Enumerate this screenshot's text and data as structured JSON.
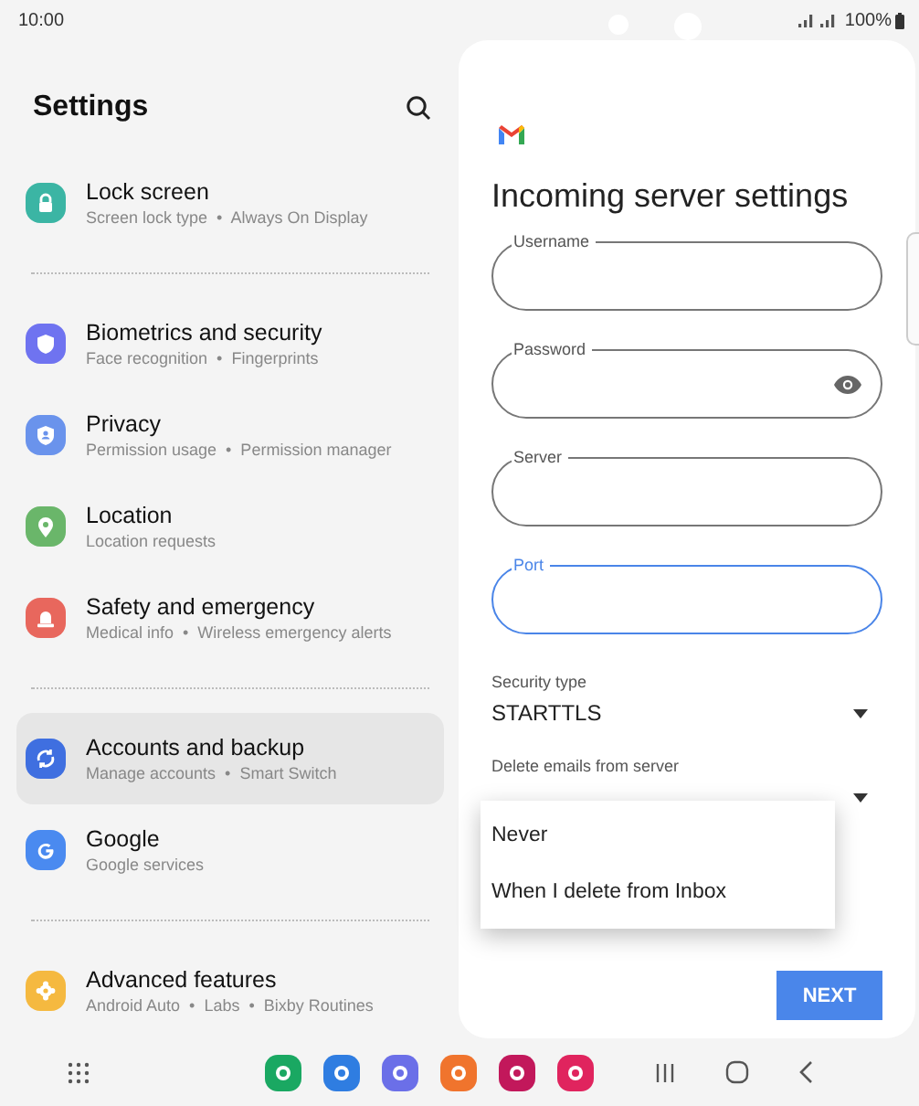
{
  "status_bar": {
    "time": "10:00",
    "battery": "100%"
  },
  "settings": {
    "title": "Settings",
    "groups": [
      {
        "items": [
          {
            "title": "Lock screen",
            "subtitle": "Screen lock type  •  Always On Display",
            "kind": "lock",
            "color": "#3bb5a4",
            "selected": false
          }
        ]
      },
      {
        "items": [
          {
            "title": "Biometrics and security",
            "subtitle": "Face recognition  •  Fingerprints",
            "kind": "shield",
            "color": "#6f73f0",
            "selected": false
          },
          {
            "title": "Privacy",
            "subtitle": "Permission usage  •  Permission manager",
            "kind": "badge",
            "color": "#6a93ec",
            "selected": false
          },
          {
            "title": "Location",
            "subtitle": "Location requests",
            "kind": "pin",
            "color": "#6ab66a",
            "selected": false
          },
          {
            "title": "Safety and emergency",
            "subtitle": "Medical info  •  Wireless emergency alerts",
            "kind": "siren",
            "color": "#e8675d",
            "selected": false
          }
        ]
      },
      {
        "items": [
          {
            "title": "Accounts and backup",
            "subtitle": "Manage accounts  •  Smart Switch",
            "kind": "sync",
            "color": "#3f6fe0",
            "selected": true
          },
          {
            "title": "Google",
            "subtitle": "Google services",
            "kind": "google",
            "color": "#4a8af0",
            "selected": false
          }
        ]
      },
      {
        "items": [
          {
            "title": "Advanced features",
            "subtitle": "Android Auto  •  Labs  •  Bixby Routines",
            "kind": "gear",
            "color": "#f5b940",
            "selected": false
          }
        ]
      }
    ]
  },
  "server_form": {
    "title": "Incoming server settings",
    "fields": [
      {
        "label": "Username",
        "kind": "text",
        "focused": false
      },
      {
        "label": "Password",
        "kind": "password",
        "focused": false
      },
      {
        "label": "Server",
        "kind": "text",
        "focused": false
      },
      {
        "label": "Port",
        "kind": "text",
        "focused": true
      }
    ],
    "selects": [
      {
        "label": "Security type",
        "value": "STARTTLS"
      },
      {
        "label": "Delete emails from server"
      }
    ],
    "menu": {
      "options": [
        "Never",
        "When I delete from Inbox"
      ]
    },
    "next_button": "NEXT"
  }
}
